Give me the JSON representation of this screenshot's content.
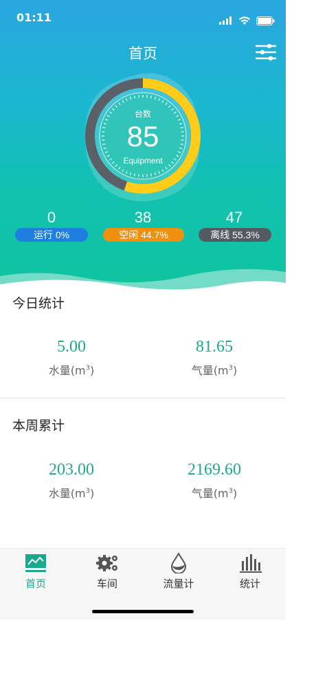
{
  "status_bar": {
    "time": "01:11"
  },
  "header": {
    "title": "首页"
  },
  "gauge": {
    "label": "台数",
    "value": "85",
    "sublabel": "Equipment",
    "fraction_used": 0.553,
    "fraction_idle": 0.447
  },
  "stats": [
    {
      "count": "0",
      "pill": "运行 0%",
      "color": "#1e7fe0"
    },
    {
      "count": "38",
      "pill": "空闲 44.7%",
      "color": "#f0900f"
    },
    {
      "count": "47",
      "pill": "离线 55.3%",
      "color": "#555a62"
    }
  ],
  "today": {
    "title": "今日统计",
    "water_value": "5.00",
    "water_label": "水量(m",
    "gas_value": "81.65",
    "gas_label": "气量(m",
    "unit_exp": "3",
    "close": ")"
  },
  "week": {
    "title": "本周累计",
    "water_value": "203.00",
    "water_label": "水量(m",
    "gas_value": "2169.60",
    "gas_label": "气量(m",
    "unit_exp": "3",
    "close": ")"
  },
  "tabs": [
    {
      "label": "首页",
      "icon": "chart-line-icon",
      "active": true
    },
    {
      "label": "车间",
      "icon": "gears-icon",
      "active": false
    },
    {
      "label": "流量计",
      "icon": "water-drop-icon",
      "active": false
    },
    {
      "label": "统计",
      "icon": "bar-chart-icon",
      "active": false
    }
  ],
  "colors": {
    "accent": "#1aa98e",
    "gauge_yellow": "#ffcc1a",
    "gauge_gray": "#5a5f68"
  }
}
